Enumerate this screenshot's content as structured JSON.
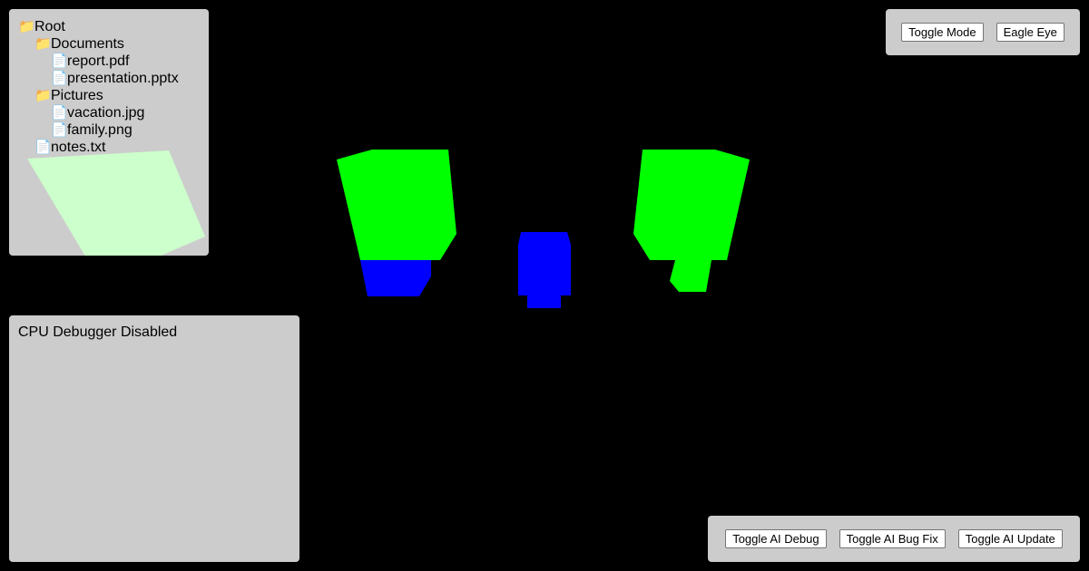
{
  "file_tree": {
    "items": [
      {
        "label": "Root",
        "icon": "folder-icon",
        "depth": 0
      },
      {
        "label": "Documents",
        "icon": "folder-icon",
        "depth": 1
      },
      {
        "label": "report.pdf",
        "icon": "file-icon",
        "depth": 2
      },
      {
        "label": "presentation.pptx",
        "icon": "file-icon",
        "depth": 2
      },
      {
        "label": "Pictures",
        "icon": "folder-icon",
        "depth": 1
      },
      {
        "label": "vacation.jpg",
        "icon": "file-icon",
        "depth": 2
      },
      {
        "label": "family.png",
        "icon": "file-icon",
        "depth": 2
      },
      {
        "label": "notes.txt",
        "icon": "file-icon",
        "depth": 1
      }
    ]
  },
  "debugger": {
    "status_text": "CPU Debugger Disabled"
  },
  "top_controls": {
    "toggle_mode_label": "Toggle Mode",
    "eagle_eye_label": "Eagle Eye"
  },
  "bottom_controls": {
    "ai_debug_label": "Toggle AI Debug",
    "ai_bug_fix_label": "Toggle AI Bug Fix",
    "ai_update_label": "Toggle AI Update"
  },
  "colors": {
    "background": "#000000",
    "panel": "#cccccc",
    "structure_green": "#00ff00",
    "structure_blue": "#0000ff",
    "minimap_view": "#ccffcc"
  }
}
